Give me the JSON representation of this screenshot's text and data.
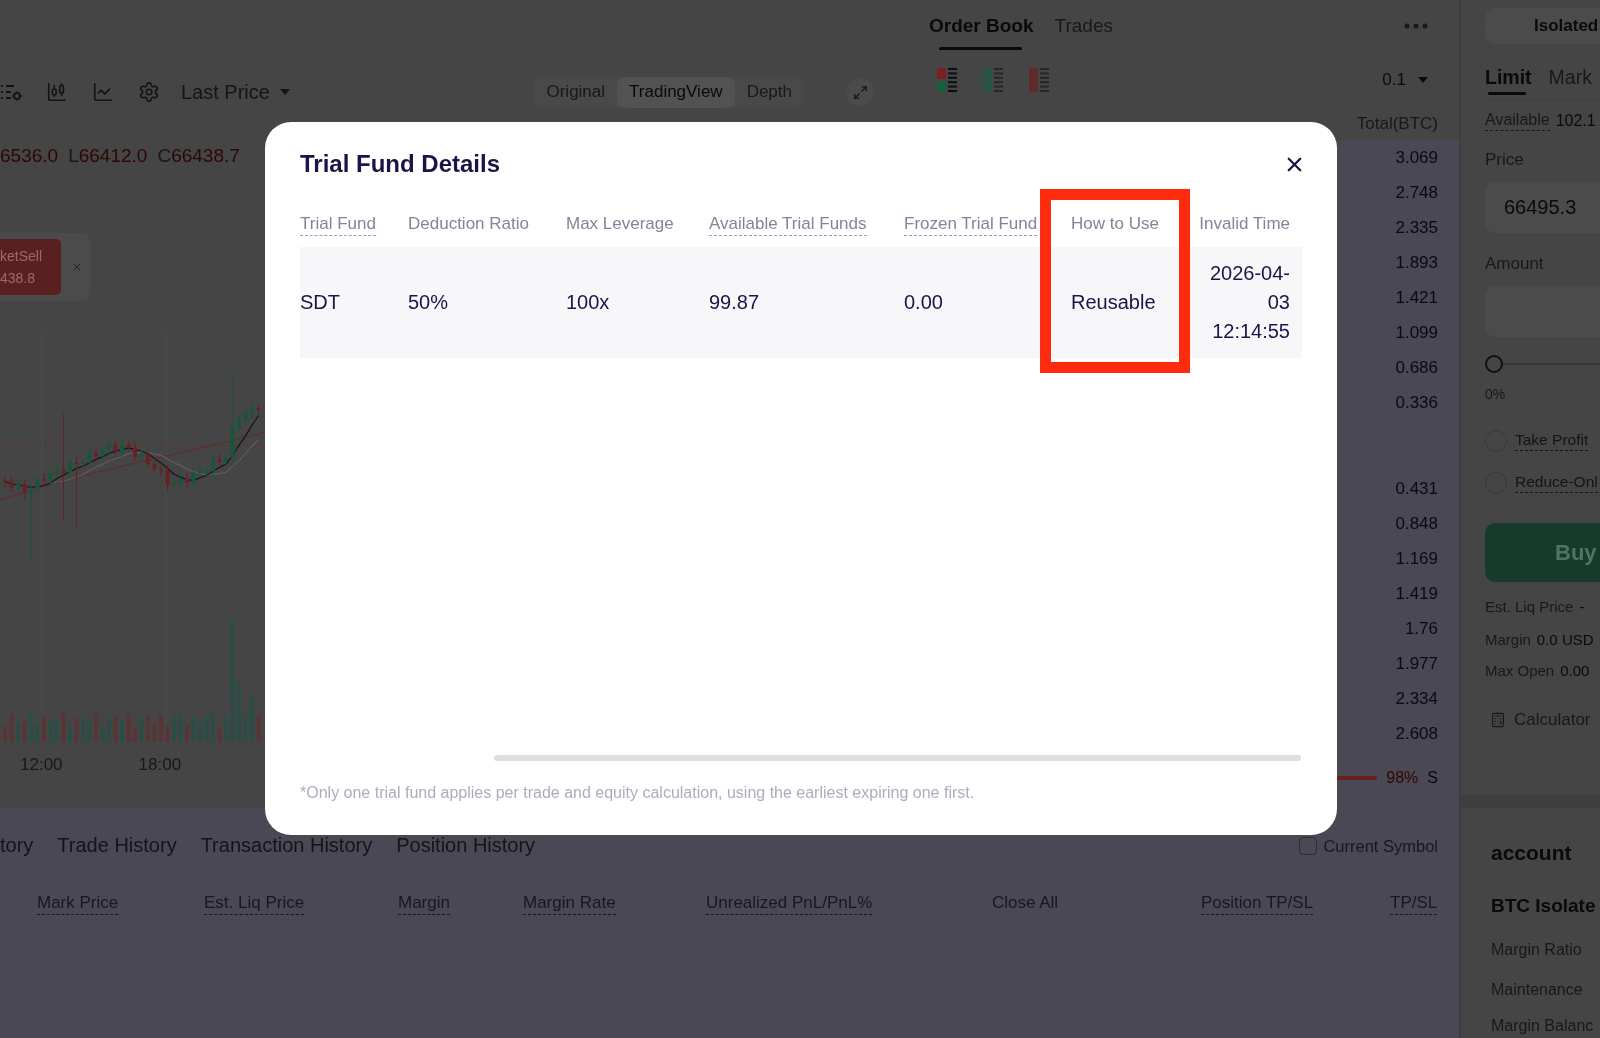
{
  "chart": {
    "price_source": "Last Price",
    "views": [
      {
        "label": "Original",
        "selected": false
      },
      {
        "label": "TradingView",
        "selected": true
      },
      {
        "label": "Depth",
        "selected": false
      }
    ],
    "ohlc": [
      {
        "value": "6536.0"
      },
      {
        "label": "L",
        "value": "66412.0"
      },
      {
        "label": "C",
        "value": "66438.7"
      }
    ],
    "order_tag": [
      "ketSell",
      "438.8"
    ],
    "time_labels": [
      "12:00",
      "18:00"
    ]
  },
  "order_book": {
    "tabs": [
      {
        "label": "Order Book",
        "selected": true
      },
      {
        "label": "Trades",
        "selected": false
      }
    ],
    "view_modes": [
      {
        "kind": "both",
        "selected": true
      },
      {
        "kind": "bids",
        "selected": false
      },
      {
        "kind": "asks",
        "selected": false
      }
    ],
    "precision": "0.1",
    "column": "Total(BTC)",
    "asks": [
      "3.069",
      "2.748",
      "2.335",
      "1.893",
      "1.421",
      "1.099",
      "0.686",
      "0.336"
    ],
    "bids": [
      "0.431",
      "0.848",
      "1.169",
      "1.419",
      "1.76",
      "1.977",
      "2.334",
      "2.608"
    ],
    "sell_ratio": {
      "value": "98%",
      "side": "S"
    }
  },
  "trade_form": {
    "margin_mode": "Isolated",
    "order_types": [
      {
        "label": "Limit",
        "selected": true
      },
      {
        "label": "Mark",
        "selected": false
      }
    ],
    "available": {
      "label": "Available",
      "value": "102.1",
      "tooltip": true
    },
    "price": {
      "label": "Price",
      "value": "66495.3"
    },
    "amount": {
      "label": "Amount"
    },
    "amount_slider": {
      "level": 0,
      "reading": "0%"
    },
    "options": [
      {
        "label": "Take Profit",
        "checked": false,
        "tooltip": true
      },
      {
        "label": "Reduce-Onl",
        "checked": false,
        "tooltip": true
      }
    ],
    "submit": "Buy",
    "summary": [
      {
        "label": "Est. Liq Price",
        "value": "-"
      },
      {
        "label": "Margin",
        "value": "0.0 USD"
      },
      {
        "label": "Max Open",
        "value": "0.00"
      }
    ],
    "calculator": "Calculator"
  },
  "account": {
    "title": "account",
    "mode": "BTC Isolate",
    "rows": [
      "Margin Ratio",
      "Maintenance",
      "Margin Balanc"
    ]
  },
  "positions": {
    "tabs": [
      {
        "label": "tory",
        "selected": false
      },
      {
        "label": "Trade History",
        "selected": false
      },
      {
        "label": "Transaction History",
        "selected": false
      },
      {
        "label": "Position History",
        "selected": false
      }
    ],
    "current_symbol": {
      "label": "Current Symbol",
      "checked": false
    },
    "columns": [
      {
        "label": "Mark Price",
        "tooltip": true
      },
      {
        "label": "Est. Liq Price",
        "tooltip": true
      },
      {
        "label": "Margin",
        "tooltip": true
      },
      {
        "label": "Margin Rate",
        "tooltip": true
      },
      {
        "label": "Unrealized PnL/PnL%",
        "tooltip": true
      },
      {
        "label": "Close All",
        "tooltip": false
      },
      {
        "label": "Position TP/SL",
        "tooltip": true
      },
      {
        "label": "TP/SL",
        "tooltip": true
      }
    ]
  },
  "dialog": {
    "title": "Trial Fund Details",
    "columns": [
      {
        "label": "Trial Fund",
        "tooltip": true,
        "highlighted": false
      },
      {
        "label": "Deduction Ratio",
        "tooltip": false,
        "highlighted": false
      },
      {
        "label": "Max Leverage",
        "tooltip": false,
        "highlighted": false
      },
      {
        "label": "Available Trial Funds",
        "tooltip": true,
        "highlighted": false
      },
      {
        "label": "Frozen Trial Fund",
        "tooltip": true,
        "highlighted": false
      },
      {
        "label": "How to Use",
        "tooltip": false,
        "highlighted": true
      },
      {
        "label": "Invalid Time",
        "tooltip": false,
        "highlighted": false
      }
    ],
    "rows": [
      {
        "cells": [
          "SDT",
          "50%",
          "100x",
          "99.87",
          "0.00",
          "Reusable",
          "2026-04-03 12:14:55"
        ]
      }
    ],
    "note": "*Only one trial fund applies per trade and equity calculation, using the earliest expiring one first."
  }
}
